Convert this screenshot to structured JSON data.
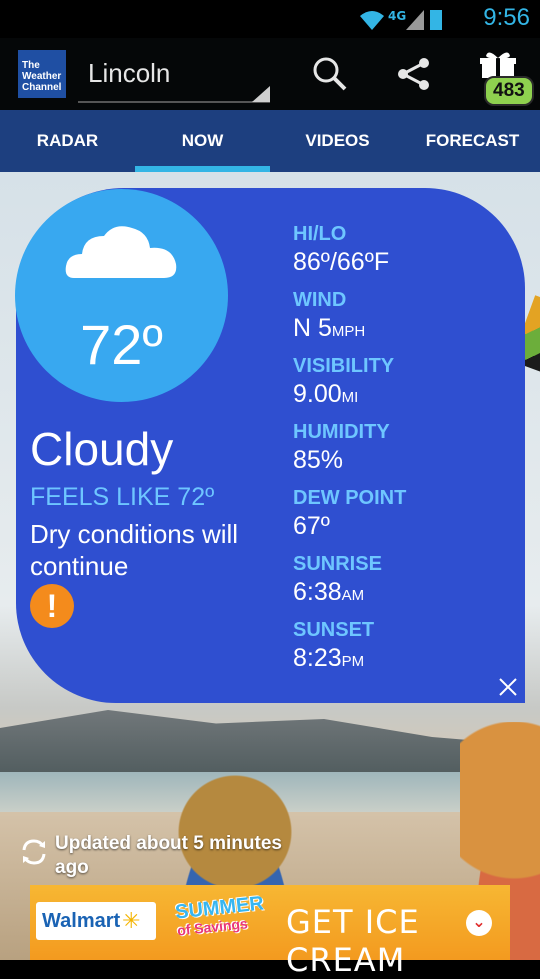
{
  "status_bar": {
    "time": "9:56",
    "network": "4G LTE"
  },
  "app_bar": {
    "logo_text": "The Weather Channel",
    "city": "Lincoln",
    "gift_count": "483"
  },
  "tabs": [
    {
      "label": "RADAR"
    },
    {
      "label": "NOW",
      "active": true
    },
    {
      "label": "VIDEOS"
    },
    {
      "label": "FORECAST"
    }
  ],
  "current": {
    "temperature": "72º",
    "condition": "Cloudy",
    "feels_like": "FEELS LIKE 72º",
    "description": "Dry conditions will continue",
    "alert_icon": "!"
  },
  "stats": [
    {
      "label": "HI/LO",
      "value": "86º/66ºF",
      "unit": ""
    },
    {
      "label": "WIND",
      "value": "N 5",
      "unit": "MPH"
    },
    {
      "label": "VISIBILITY",
      "value": "9.00",
      "unit": "MI"
    },
    {
      "label": "HUMIDITY",
      "value": "85%",
      "unit": ""
    },
    {
      "label": "DEW POINT",
      "value": "67º",
      "unit": ""
    },
    {
      "label": "SUNRISE",
      "value": "6:38",
      "unit": "AM"
    },
    {
      "label": "SUNSET",
      "value": "8:23",
      "unit": "PM"
    }
  ],
  "updated_text": "Updated about 5 minutes ago",
  "ad": {
    "brand": "Walmart",
    "promo_line1": "SUMMER",
    "promo_line2": "of Savings",
    "cta": "GET ICE CREAM"
  },
  "colors": {
    "card": "#2f4fd0",
    "accent_blue": "#33b5e5",
    "label_blue": "#6ec6ff",
    "tab_bar": "#1d3f7f",
    "alert": "#f48b1c",
    "badge": "#8fd14f"
  }
}
